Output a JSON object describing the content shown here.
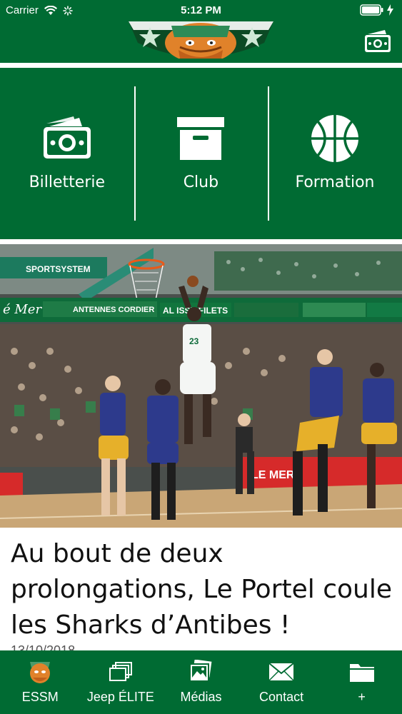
{
  "status_bar": {
    "carrier": "Carrier",
    "time": "5:12 PM"
  },
  "header": {
    "logo_icon": "club-mascot-logo",
    "right_icon": "ticket-money-icon"
  },
  "tiles": [
    {
      "label": "Billetterie",
      "icon": "ticket-money-icon"
    },
    {
      "label": "Club",
      "icon": "box-archive-icon"
    },
    {
      "label": "Formation",
      "icon": "basketball-icon"
    }
  ],
  "article": {
    "headline": "Au bout de deux prolongations, Le Portel coule les Sharks d’Antibes !",
    "date": "13/10/2018"
  },
  "tabbar": [
    {
      "label": "ESSM",
      "icon": "mascot-icon"
    },
    {
      "label": "Jeep ÉLITE",
      "icon": "stacked-pages-icon"
    },
    {
      "label": "Médias",
      "icon": "photos-icon"
    },
    {
      "label": "Contact",
      "icon": "envelope-icon"
    },
    {
      "label": "+",
      "icon": "folder-icon"
    }
  ],
  "colors": {
    "brand_green": "#006b33",
    "white": "#ffffff"
  }
}
